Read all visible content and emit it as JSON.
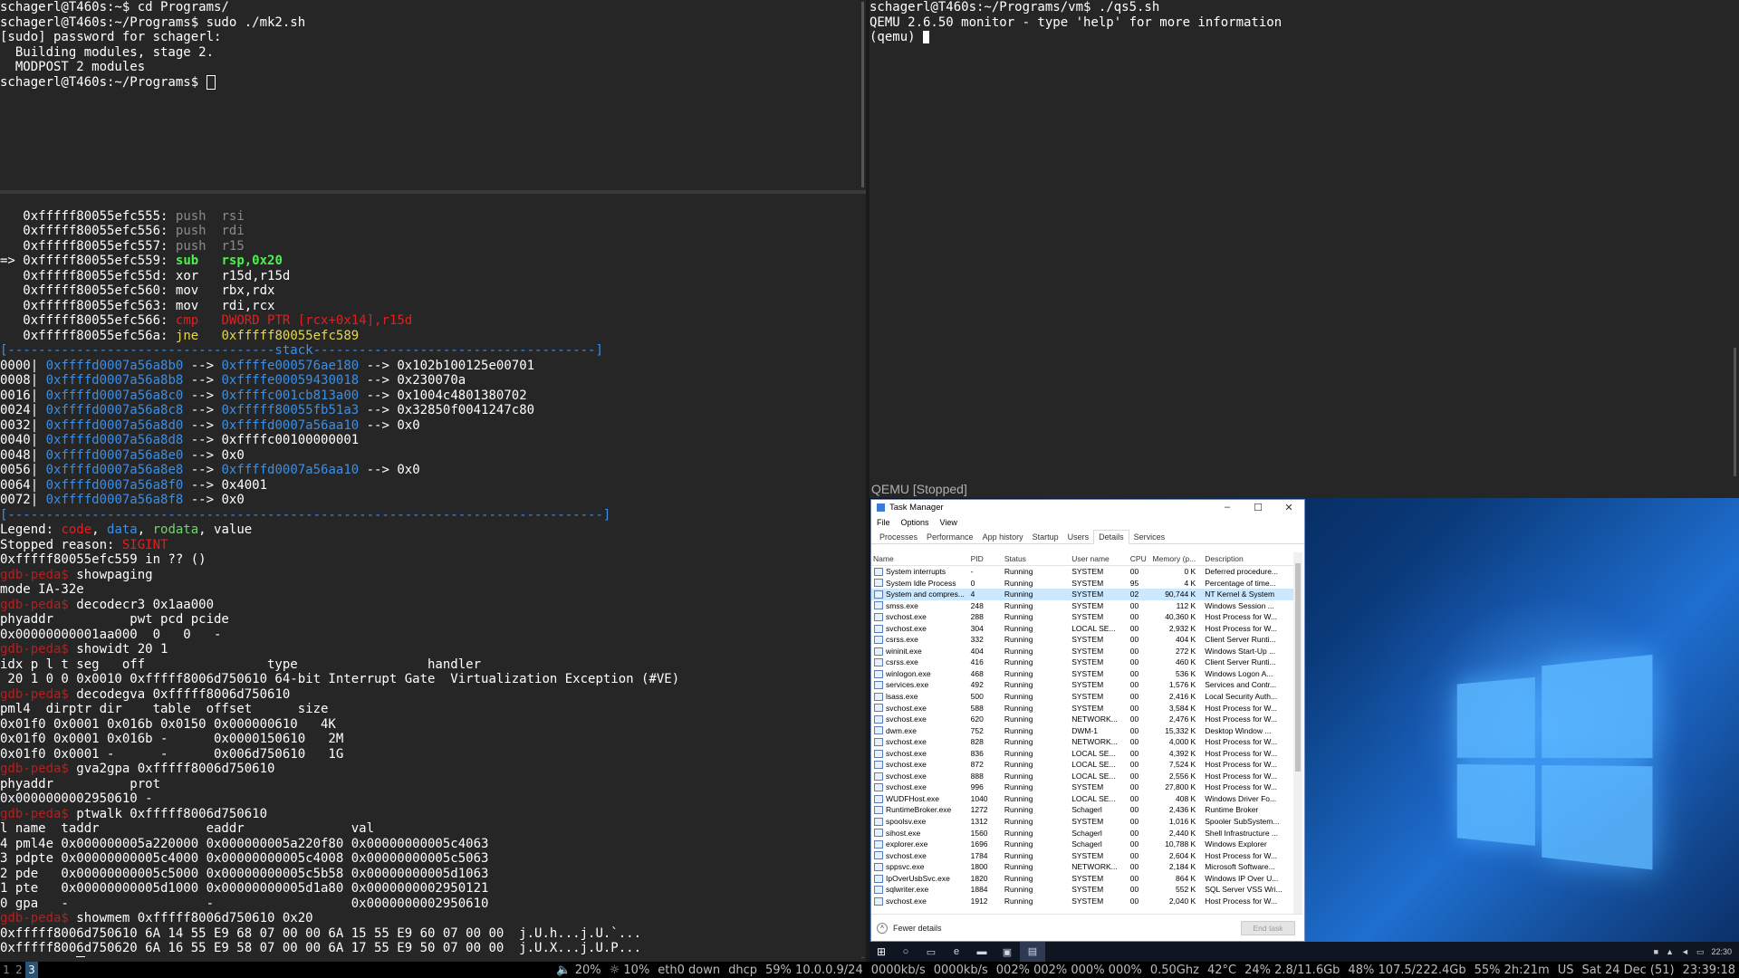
{
  "terminal_top_left": {
    "lines": [
      "schagerl@T460s:~$ cd Programs/",
      "schagerl@T460s:~/Programs$ sudo ./mk2.sh",
      "[sudo] password for schagerl:",
      "  Building modules, stage 2.",
      "  MODPOST 2 modules"
    ],
    "prompt": "schagerl@T460s:~/Programs$ "
  },
  "terminal_top_right": {
    "lines": [
      "schagerl@T460s:~/Programs/vm$ ./qs5.sh",
      "QEMU 2.6.50 monitor - type 'help' for more information"
    ],
    "prompt": "(qemu) "
  },
  "gdb": {
    "code": [
      {
        "marker": "   ",
        "addr": "0xfffff80055efc555:",
        "op": "push",
        "args": "rsi",
        "style": "grey"
      },
      {
        "marker": "   ",
        "addr": "0xfffff80055efc556:",
        "op": "push",
        "args": "rdi",
        "style": "grey"
      },
      {
        "marker": "   ",
        "addr": "0xfffff80055efc557:",
        "op": "push",
        "args": "r15",
        "style": "grey"
      },
      {
        "marker": "=> ",
        "addr": "0xfffff80055efc559:",
        "op": "sub ",
        "args": "rsp,0x20",
        "style": "green"
      },
      {
        "marker": "   ",
        "addr": "0xfffff80055efc55d:",
        "op": "xor ",
        "args": "r15d,r15d",
        "style": "white"
      },
      {
        "marker": "   ",
        "addr": "0xfffff80055efc560:",
        "op": "mov ",
        "args": "rbx,rdx",
        "style": "white"
      },
      {
        "marker": "   ",
        "addr": "0xfffff80055efc563:",
        "op": "mov ",
        "args": "rdi,rcx",
        "style": "white"
      },
      {
        "marker": "   ",
        "addr": "0xfffff80055efc566:",
        "op": "cmp ",
        "args": "DWORD PTR [rcx+0x14],r15d",
        "style": "red"
      },
      {
        "marker": "   ",
        "addr": "0xfffff80055efc56a:",
        "op": "jne ",
        "args": "0xfffff80055efc589",
        "style": "yellow"
      }
    ],
    "stack_header": "[-----------------------------------stack-------------------------------------]",
    "stack": [
      {
        "off": "0000|",
        "a": "0xffffd0007a56a8b0",
        "b": "0xffffe000576ae180",
        "c": "0x102b100125e00701"
      },
      {
        "off": "0008|",
        "a": "0xffffd0007a56a8b8",
        "b": "0xffffe00059430018",
        "c": "0x230070a"
      },
      {
        "off": "0016|",
        "a": "0xffffd0007a56a8c0",
        "b": "0xffffc001cb813a00",
        "c": "0x1004c4801380702"
      },
      {
        "off": "0024|",
        "a": "0xffffd0007a56a8c8",
        "b": "0xfffff80055fb51a3",
        "c": "0x32850f0041247c80"
      },
      {
        "off": "0032|",
        "a": "0xffffd0007a56a8d0",
        "b": "0xffffd0007a56aa10",
        "c": "0x0"
      },
      {
        "off": "0040|",
        "a": "0xffffd0007a56a8d8",
        "b": "",
        "c": "0xffffc00100000001"
      },
      {
        "off": "0048|",
        "a": "0xffffd0007a56a8e0",
        "b": "",
        "c": "0x0"
      },
      {
        "off": "0056|",
        "a": "0xffffd0007a56a8e8",
        "b": "0xffffd0007a56aa10",
        "c": "0x0"
      },
      {
        "off": "0064|",
        "a": "0xffffd0007a56a8f0",
        "b": "",
        "c": "0x4001"
      },
      {
        "off": "0072|",
        "a": "0xffffd0007a56a8f8",
        "b": "",
        "c": "0x0"
      }
    ],
    "stack_footer": "[------------------------------------------------------------------------------]",
    "legend_label": "Legend: ",
    "legend_code": "code",
    "legend_data": "data",
    "legend_rodata": "rodata",
    "legend_value": "value",
    "stopped_label": "Stopped reason: ",
    "stopped_reason": "SIGINT",
    "where": "0xfffff80055efc559 in ?? ()",
    "prompt": "gdb-peda$ ",
    "session": [
      {
        "type": "cmd",
        "text": "showpaging"
      },
      {
        "type": "out",
        "text": "mode IA-32e"
      },
      {
        "type": "cmd",
        "text": "decodecr3 0x1aa000"
      },
      {
        "type": "out",
        "text": "phyaddr          pwt pcd pcide"
      },
      {
        "type": "out",
        "text": "0x00000000001aa000  0   0   -"
      },
      {
        "type": "cmd",
        "text": "showidt 20 1"
      },
      {
        "type": "out",
        "text": "idx p l t seg   off                type                 handler"
      },
      {
        "type": "out",
        "text": " 20 1 0 0 0x0010 0xfffff8006d750610 64-bit Interrupt Gate  Virtualization Exception (#VE)"
      },
      {
        "type": "cmd",
        "text": "decodegva 0xfffff8006d750610"
      },
      {
        "type": "out",
        "text": "pml4  dirptr dir    table  offset      size"
      },
      {
        "type": "out",
        "text": "0x01f0 0x0001 0x016b 0x0150 0x000000610   4K"
      },
      {
        "type": "out",
        "text": "0x01f0 0x0001 0x016b -      0x0000150610   2M"
      },
      {
        "type": "out",
        "text": "0x01f0 0x0001 -      -      0x006d750610   1G"
      },
      {
        "type": "cmd",
        "text": "gva2gpa 0xfffff8006d750610"
      },
      {
        "type": "out",
        "text": "phyaddr          prot"
      },
      {
        "type": "out",
        "text": "0x0000000002950610 -"
      },
      {
        "type": "cmd",
        "text": "ptwalk 0xfffff8006d750610"
      },
      {
        "type": "out",
        "text": "l name  taddr              eaddr              val"
      },
      {
        "type": "out",
        "text": "4 pml4e 0x000000005a220000 0x000000005a220f80 0x00000000005c4063"
      },
      {
        "type": "out",
        "text": "3 pdpte 0x00000000005c4000 0x00000000005c4008 0x00000000005c5063"
      },
      {
        "type": "out",
        "text": "2 pde   0x00000000005c5000 0x00000000005c5b58 0x00000000005d1063"
      },
      {
        "type": "out",
        "text": "1 pte   0x00000000005d1000 0x00000000005d1a80 0x0000000002950121"
      },
      {
        "type": "out",
        "text": "0 gpa   -                  -                  0x0000000002950610"
      },
      {
        "type": "cmd",
        "text": "showmem 0xfffff8006d750610 0x20"
      },
      {
        "type": "out",
        "text": "0xfffff8006d750610 6A 14 55 E9 68 07 00 00 6A 15 55 E9 60 07 00 00  j.U.h...j.U.`..."
      },
      {
        "type": "out",
        "text": "0xfffff8006d750620 6A 16 55 E9 58 07 00 00 6A 17 55 E9 50 07 00 00  j.U.X...j.U.P..."
      }
    ]
  },
  "qemu_window": {
    "title": "QEMU [Stopped]"
  },
  "task_manager": {
    "title": "Task Manager",
    "window_buttons": [
      "–",
      "☐",
      "✕"
    ],
    "menu": [
      "File",
      "Options",
      "View"
    ],
    "tabs": [
      "Processes",
      "Performance",
      "App history",
      "Startup",
      "Users",
      "Details",
      "Services"
    ],
    "active_tab": "Details",
    "columns": [
      "Name",
      "PID",
      "Status",
      "User name",
      "CPU",
      "Memory (p...",
      "Description"
    ],
    "rows": [
      [
        "System interrupts",
        "-",
        "Running",
        "SYSTEM",
        "00",
        "0 K",
        "Deferred procedure..."
      ],
      [
        "System Idle Process",
        "0",
        "Running",
        "SYSTEM",
        "95",
        "4 K",
        "Percentage of time..."
      ],
      [
        "System and compres...",
        "4",
        "Running",
        "SYSTEM",
        "02",
        "90,744 K",
        "NT Kernel & System"
      ],
      [
        "smss.exe",
        "248",
        "Running",
        "SYSTEM",
        "00",
        "112 K",
        "Windows Session ..."
      ],
      [
        "svchost.exe",
        "288",
        "Running",
        "SYSTEM",
        "00",
        "40,360 K",
        "Host Process for W..."
      ],
      [
        "svchost.exe",
        "304",
        "Running",
        "LOCAL SE...",
        "00",
        "2,932 K",
        "Host Process for W..."
      ],
      [
        "csrss.exe",
        "332",
        "Running",
        "SYSTEM",
        "00",
        "404 K",
        "Client Server Runti..."
      ],
      [
        "wininit.exe",
        "404",
        "Running",
        "SYSTEM",
        "00",
        "272 K",
        "Windows Start-Up ..."
      ],
      [
        "csrss.exe",
        "416",
        "Running",
        "SYSTEM",
        "00",
        "460 K",
        "Client Server Runti..."
      ],
      [
        "winlogon.exe",
        "468",
        "Running",
        "SYSTEM",
        "00",
        "536 K",
        "Windows Logon A..."
      ],
      [
        "services.exe",
        "492",
        "Running",
        "SYSTEM",
        "00",
        "1,576 K",
        "Services and Contr..."
      ],
      [
        "lsass.exe",
        "500",
        "Running",
        "SYSTEM",
        "00",
        "2,416 K",
        "Local Security Auth..."
      ],
      [
        "svchost.exe",
        "588",
        "Running",
        "SYSTEM",
        "00",
        "3,584 K",
        "Host Process for W..."
      ],
      [
        "svchost.exe",
        "620",
        "Running",
        "NETWORK...",
        "00",
        "2,476 K",
        "Host Process for W..."
      ],
      [
        "dwm.exe",
        "752",
        "Running",
        "DWM-1",
        "00",
        "15,332 K",
        "Desktop Window ..."
      ],
      [
        "svchost.exe",
        "828",
        "Running",
        "NETWORK...",
        "00",
        "4,000 K",
        "Host Process for W..."
      ],
      [
        "svchost.exe",
        "836",
        "Running",
        "LOCAL SE...",
        "00",
        "4,392 K",
        "Host Process for W..."
      ],
      [
        "svchost.exe",
        "872",
        "Running",
        "LOCAL SE...",
        "00",
        "7,524 K",
        "Host Process for W..."
      ],
      [
        "svchost.exe",
        "888",
        "Running",
        "LOCAL SE...",
        "00",
        "2,556 K",
        "Host Process for W..."
      ],
      [
        "svchost.exe",
        "996",
        "Running",
        "SYSTEM",
        "00",
        "27,800 K",
        "Host Process for W..."
      ],
      [
        "WUDFHost.exe",
        "1040",
        "Running",
        "LOCAL SE...",
        "00",
        "408 K",
        "Windows Driver Fo..."
      ],
      [
        "RuntimeBroker.exe",
        "1272",
        "Running",
        "Schagerl",
        "00",
        "2,436 K",
        "Runtime Broker"
      ],
      [
        "spoolsv.exe",
        "1312",
        "Running",
        "SYSTEM",
        "00",
        "1,016 K",
        "Spooler SubSystem..."
      ],
      [
        "sihost.exe",
        "1560",
        "Running",
        "Schagerl",
        "00",
        "2,440 K",
        "Shell Infrastructure ..."
      ],
      [
        "explorer.exe",
        "1696",
        "Running",
        "Schagerl",
        "00",
        "10,788 K",
        "Windows Explorer"
      ],
      [
        "svchost.exe",
        "1784",
        "Running",
        "SYSTEM",
        "00",
        "2,604 K",
        "Host Process for W..."
      ],
      [
        "sppsvc.exe",
        "1800",
        "Running",
        "NETWORK...",
        "00",
        "2,184 K",
        "Microsoft Software..."
      ],
      [
        "IpOverUsbSvc.exe",
        "1820",
        "Running",
        "SYSTEM",
        "00",
        "864 K",
        "Windows IP Over U..."
      ],
      [
        "sqlwriter.exe",
        "1884",
        "Running",
        "SYSTEM",
        "00",
        "552 K",
        "SQL Server VSS Wri..."
      ],
      [
        "svchost.exe",
        "1912",
        "Running",
        "SYSTEM",
        "00",
        "2,040 K",
        "Host Process for W..."
      ]
    ],
    "selected_row": 2,
    "fewer_details": "Fewer details",
    "end_task": "End task"
  },
  "vm_taskbar": {
    "clock": "22:30"
  },
  "statusbar": {
    "workspaces": [
      "1",
      "2",
      "3"
    ],
    "focused_workspace": "3",
    "items": [
      "🔈 20%",
      "☼ 10%",
      "eth0 down",
      "dhcp",
      "59% 10.0.0.9/24",
      "0000kb/s",
      "0000kb/s",
      "002% 002% 000% 000%",
      "0.50Ghz",
      "42°C",
      "24% 2.8/11.6Gb",
      "48% 107.5/222.4Gb",
      "55% 2h:21m",
      "US",
      "Sat 24 Dec (51)",
      "23:39:18"
    ]
  }
}
